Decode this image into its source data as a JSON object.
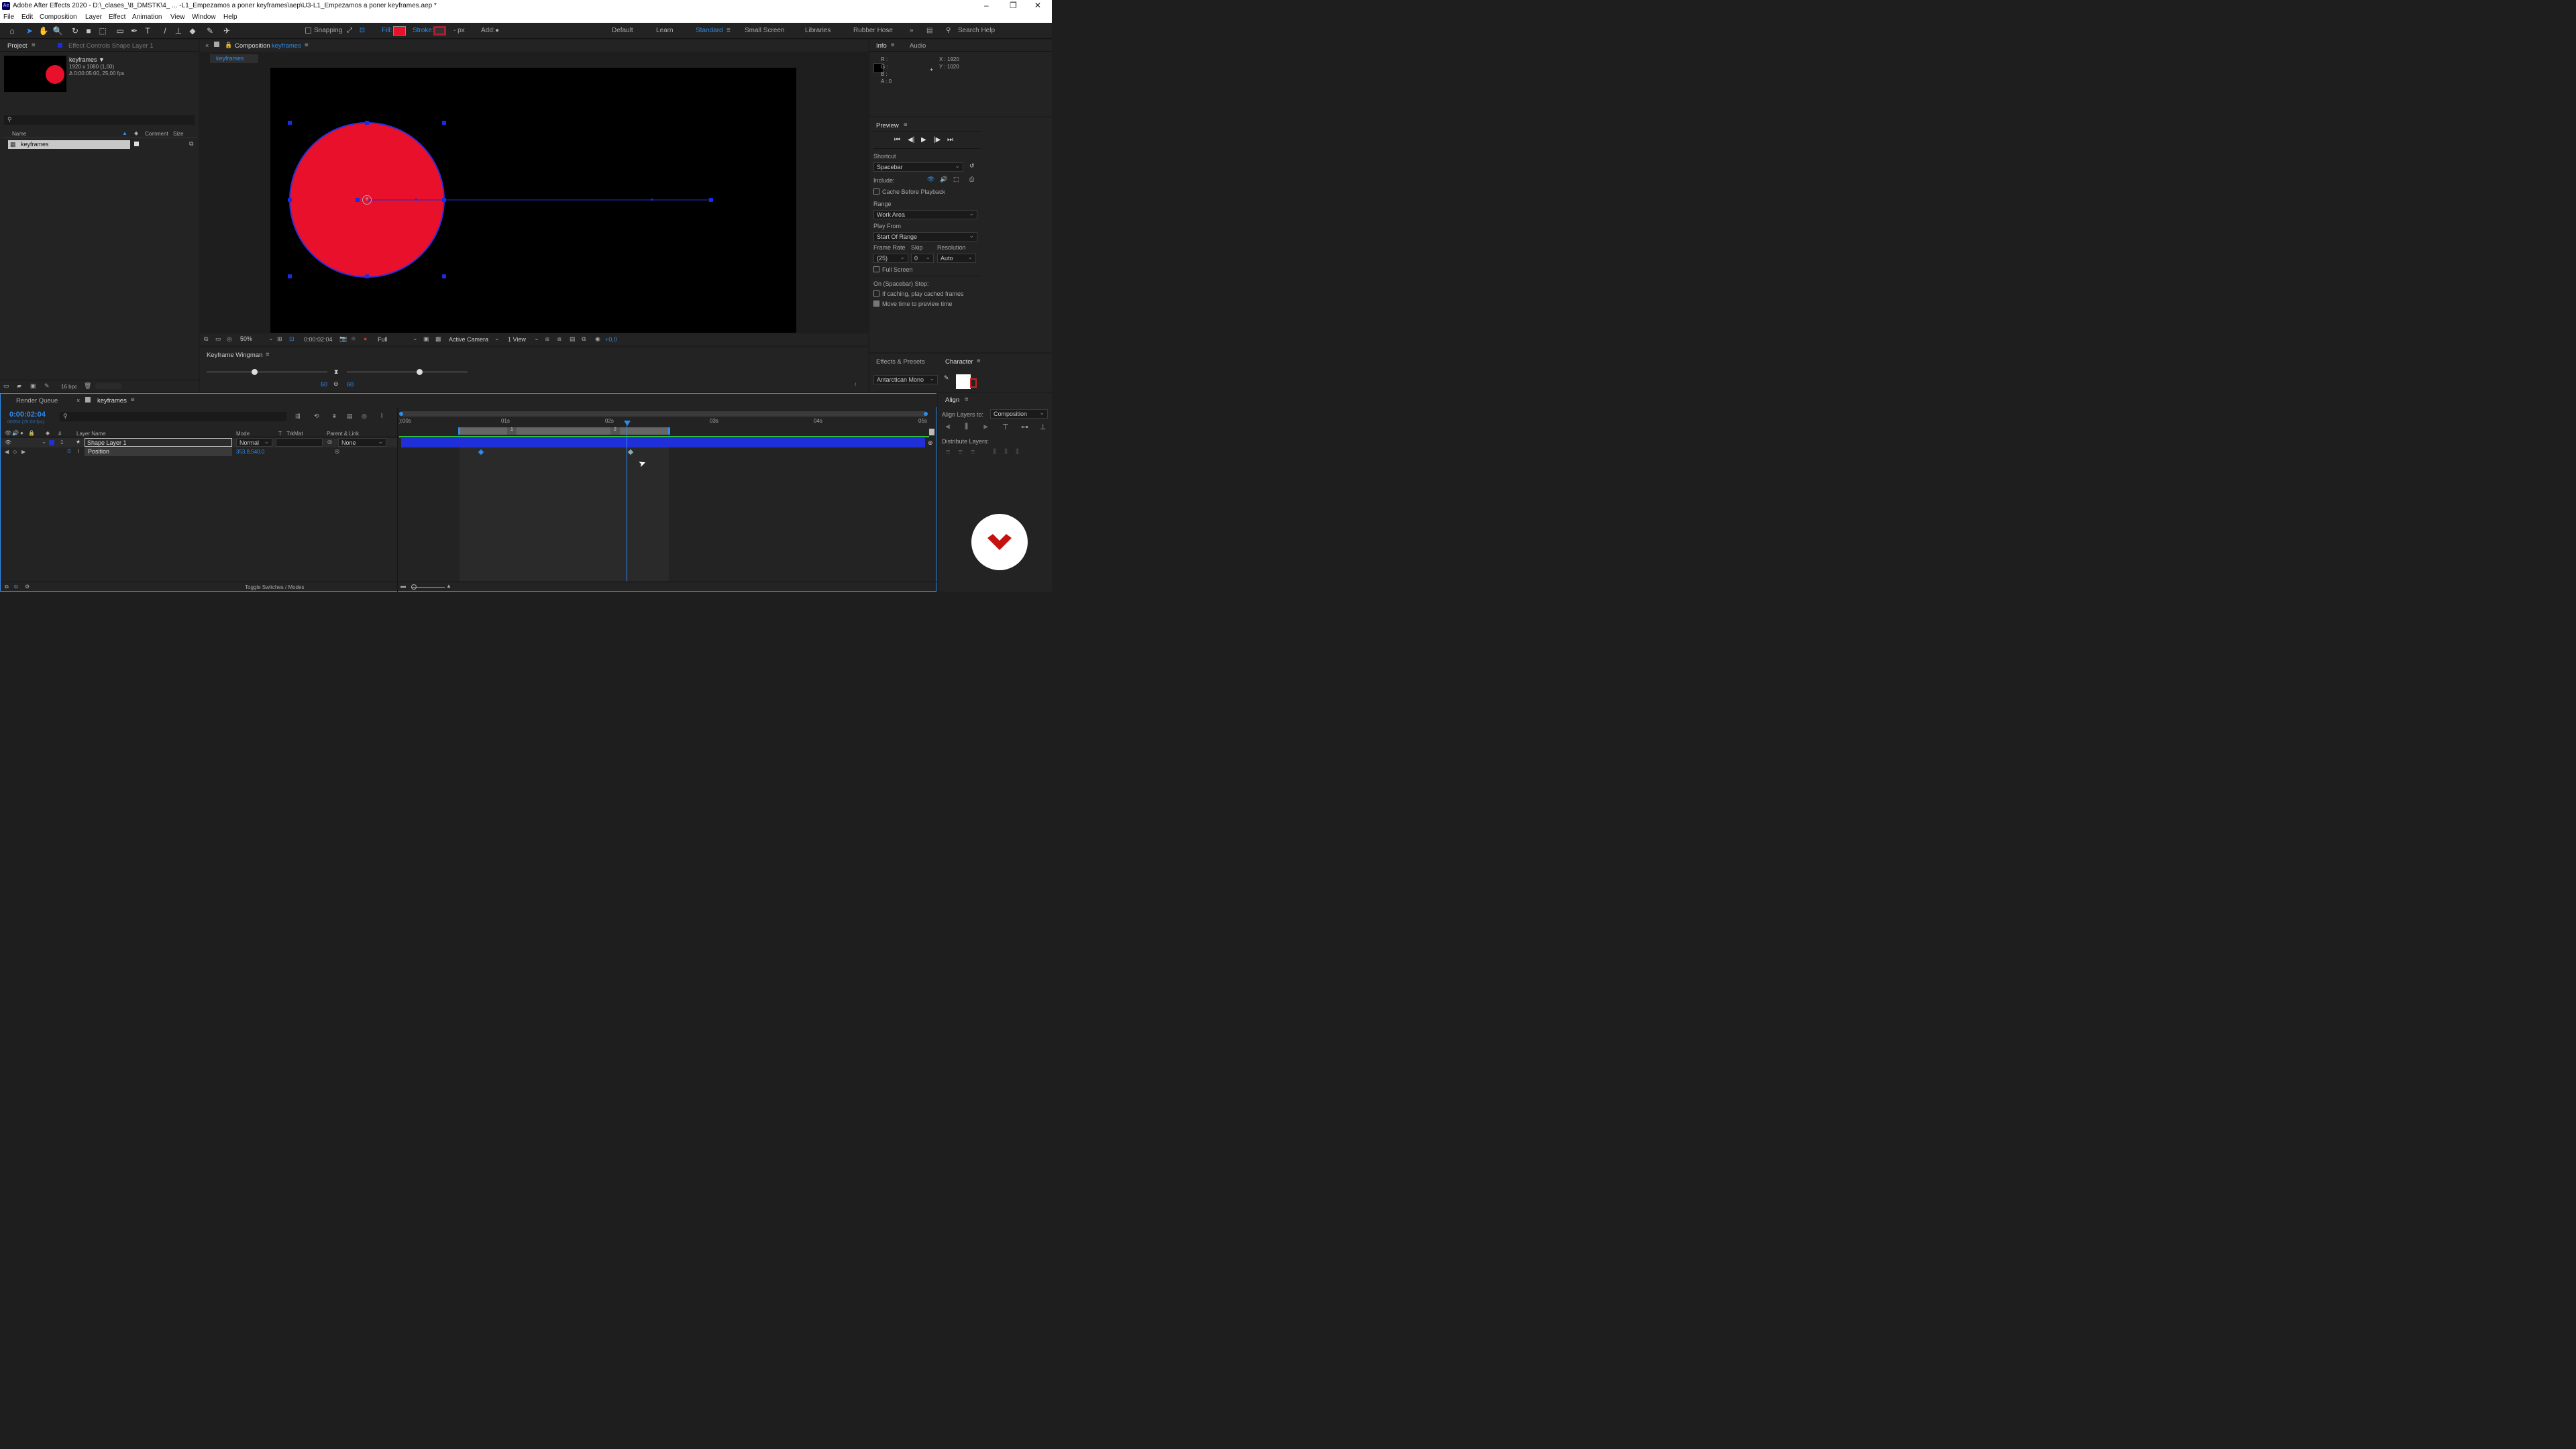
{
  "window": {
    "app_icon": "Ae",
    "title": "Adobe After Effects 2020 - D:\\_clases_\\8_DMSTK\\4_ ... -L1_Empezamos a poner keyframes\\aep\\U3-L1_Empezamos a poner keyframes.aep *"
  },
  "menu": [
    "File",
    "Edit",
    "Composition",
    "Layer",
    "Effect",
    "Animation",
    "View",
    "Window",
    "Help"
  ],
  "toolbar": {
    "snapping": "Snapping",
    "fill": "Fill:",
    "stroke": "Stroke:",
    "px": "- px",
    "add": "Add:",
    "workspaces": [
      "Default",
      "Learn",
      "Standard",
      "Small Screen",
      "Libraries",
      "Rubber Hose"
    ],
    "search_placeholder": "Search Help",
    "fill_color": "#e8102a"
  },
  "project": {
    "tab": "Project",
    "effect_controls_tab": "Effect Controls Shape Layer 1",
    "item_name": "keyframes ▼",
    "item_res": "1920 x 1080 (1,00)",
    "item_dur": "Δ 0:00:05:00, 25,00 fps",
    "col_name": "Name",
    "col_comment": "Comment",
    "col_size": "Size",
    "row_name": "keyframes",
    "bpc": "16 bpc"
  },
  "composition": {
    "tab_label": "Composition",
    "tab_name": "keyframes",
    "sub_tab": "keyframes",
    "zoom": "50%",
    "timecode": "0:00:02:04",
    "resolution": "Full",
    "camera": "Active Camera",
    "view": "1 View",
    "exposure": "+0,0",
    "circle_color": "#e8102a"
  },
  "wingman": {
    "title": "Keyframe Wingman",
    "left_value": "60",
    "right_value": "60"
  },
  "info": {
    "tab": "Info",
    "audio_tab": "Audio",
    "r": "R :",
    "g": "G :",
    "b": "B :",
    "a": "A : 0",
    "x": "X : 1920",
    "y": "Y : 1020"
  },
  "preview": {
    "title": "Preview",
    "shortcut_label": "Shortcut",
    "shortcut": "Spacebar",
    "include": "Include:",
    "cache": "Cache Before Playback",
    "range_label": "Range",
    "range": "Work Area",
    "play_from_label": "Play From",
    "play_from": "Start Of Range",
    "frame_rate_label": "Frame Rate",
    "frame_rate": "(25)",
    "skip_label": "Skip",
    "skip": "0",
    "resolution_label": "Resolution",
    "resolution": "Auto",
    "full_screen": "Full Screen",
    "stop_label": "On (Spacebar) Stop:",
    "if_caching": "If caching, play cached frames",
    "move_time": "Move time to preview time"
  },
  "effects": {
    "tab": "Effects & Presets",
    "character_tab": "Character",
    "font": "Antarctican Mono"
  },
  "align": {
    "title": "Align",
    "align_to_label": "Align Layers to:",
    "align_to": "Composition",
    "distribute": "Distribute Layers:"
  },
  "timeline": {
    "render_queue": "Render Queue",
    "comp_tab": "keyframes",
    "timecode": "0:00:02:04",
    "frame_info": "00054 (25.00 fps)",
    "col_layer_name": "Layer Name",
    "col_mode": "Mode",
    "col_t": "T",
    "col_trkmat": "TrkMat",
    "col_parent": "Parent & Link",
    "layer_num": "1",
    "layer_name": "Shape Layer 1",
    "layer_mode": "Normal",
    "layer_parent": "None",
    "prop_name": "Position",
    "prop_value": "353,8,540,0",
    "toggle": "Toggle Switches / Modes",
    "ruler": [
      "):00s",
      "01s",
      "02s",
      "03s",
      "04s",
      "05s"
    ],
    "marker1": "1",
    "marker2": "2",
    "layer_color": "#2030d8"
  }
}
